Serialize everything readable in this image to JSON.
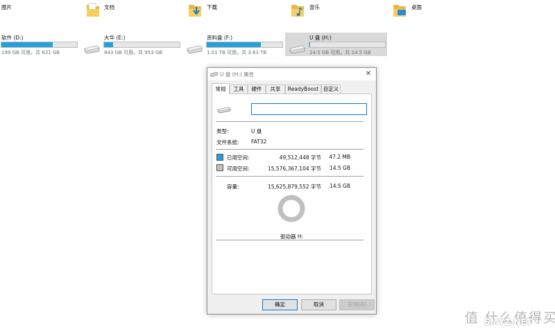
{
  "folders": [
    {
      "label": "图片",
      "icon": "pictures-folder-icon"
    },
    {
      "label": "文档",
      "icon": "documents-folder-icon"
    },
    {
      "label": "下载",
      "icon": "downloads-folder-icon"
    },
    {
      "label": "音乐",
      "icon": "music-folder-icon"
    },
    {
      "label": "桌面",
      "icon": "desktop-folder-icon"
    }
  ],
  "drives": [
    {
      "name": "软件 (D:)",
      "info": "199 GB 可用，共 631 GB",
      "used_fraction": 0.68
    },
    {
      "name": "大华 (E:)",
      "info": "843 GB 可用，共 953 GB",
      "used_fraction": 0.12
    },
    {
      "name": "资料盘 (F:)",
      "info": "1.01 TB 可用，共 3.63 TB",
      "used_fraction": 0.72
    },
    {
      "name": "U 盘 (H:)",
      "info": "14.5 GB 可用，共 14.5 GB",
      "used_fraction": 0.003
    }
  ],
  "dialog": {
    "title": "U 盘 (H:) 属性",
    "close_glyph": "✕",
    "tabs": [
      "常规",
      "工具",
      "硬件",
      "共享",
      "ReadyBoost",
      "自定义"
    ],
    "active_tab": "常规",
    "name_value": "",
    "type_label": "类型:",
    "type_value": "U 盘",
    "fs_label": "文件系统:",
    "fs_value": "FAT32",
    "used_label": "已用空间:",
    "used_bytes": "49,512,448 字节",
    "used_size": "47.2 MB",
    "free_label": "可用空间:",
    "free_bytes": "15,576,367,104 字节",
    "free_size": "14.5 GB",
    "capacity_label": "容量:",
    "capacity_bytes": "15,625,879,552 字节",
    "capacity_size": "14.5 GB",
    "drive_caption": "驱动器 H:",
    "ok_label": "确定",
    "cancel_label": "取消",
    "apply_label": "应用(A)"
  },
  "colors": {
    "used": "#26a0da",
    "free": "#c0c0c0",
    "accent": "#0078d7"
  },
  "watermark": {
    "top": "值 什么值得买",
    "bottom": "SMYZ.NET"
  }
}
